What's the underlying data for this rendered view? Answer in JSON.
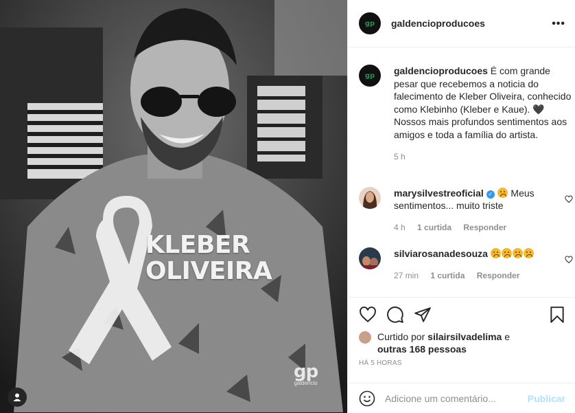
{
  "post": {
    "overlay_line1": "KLEBER",
    "overlay_line2": "OLIVEIRA",
    "watermark_logo": "gp",
    "watermark_text": "galdencio"
  },
  "header": {
    "avatar_text": "gp",
    "username": "galdencioproducoes",
    "more_label": "•••"
  },
  "caption": {
    "username": "galdencioproducoes",
    "text": " É com grande pesar que recebemos a noticia do falecimento de Kleber Oliveira, conhecido como Klebinho (Kleber e Kaue). 🖤",
    "text2": "Nossos mais profundos sentimentos aos amigos e toda a família do artista.",
    "time": "5 h"
  },
  "comments": [
    {
      "username": "marysilvestreoficial",
      "text": " Meus sentimentos... muito triste",
      "time": "4 h",
      "likes": "1 curtida",
      "reply": "Responder"
    },
    {
      "username": "silviarosanadesouza",
      "text": "",
      "time": "27 min",
      "likes": "1 curtida",
      "reply": "Responder"
    }
  ],
  "likes": {
    "prefix": "Curtido por ",
    "user": "silairsilvadelima",
    "connector": " e ",
    "others": "outras 168 pessoas"
  },
  "posted_ago": "HÁ 5 HORAS",
  "comment_box": {
    "placeholder": "Adicione um comentário...",
    "publish_label": "Publicar"
  },
  "colors": {
    "verified": "#3897f0",
    "publish_disabled": "#b2dffc",
    "meta_gray": "#8e8e8e"
  }
}
